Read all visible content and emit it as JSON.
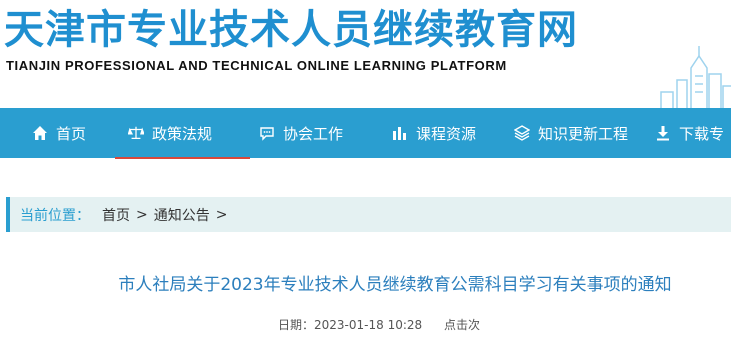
{
  "header": {
    "title": "天津市专业技术人员继续教育网",
    "subtitle": "TIANJIN PROFESSIONAL AND TECHNICAL ONLINE LEARNING PLATFORM"
  },
  "nav": {
    "items": [
      {
        "label": "首页",
        "icon": "home-icon"
      },
      {
        "label": "政策法规",
        "icon": "scales-icon"
      },
      {
        "label": "协会工作",
        "icon": "chat-icon"
      },
      {
        "label": "课程资源",
        "icon": "chart-icon"
      },
      {
        "label": "知识更新工程",
        "icon": "layers-icon"
      },
      {
        "label": "下载专",
        "icon": "download-icon"
      }
    ],
    "active_index": 1
  },
  "breadcrumb": {
    "label": "当前位置：",
    "items": [
      "首页",
      "通知公告"
    ],
    "separator": ">"
  },
  "article": {
    "title": "市人社局关于2023年专业技术人员继续教育公需科目学习有关事项的通知",
    "date_label": "日期：",
    "date": "2023-01-18 10:28",
    "clicks_label": "点击",
    "clicks_suffix": "次"
  },
  "colors": {
    "brand": "#1f8fd0",
    "nav_bg": "#2a9ed0",
    "active_underline": "#d9483b",
    "breadcrumb_bg": "#e4f1f2"
  }
}
